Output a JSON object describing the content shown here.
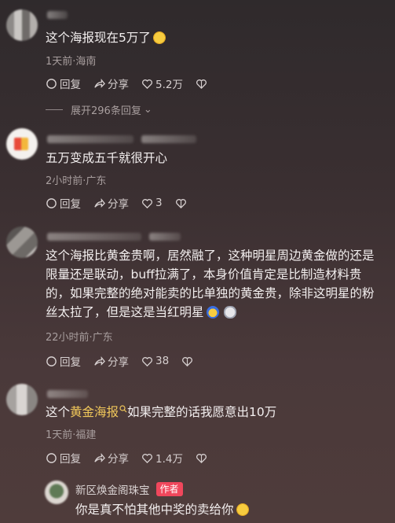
{
  "comments": [
    {
      "text": "这个海报现在5万了",
      "meta": "1天前·海南",
      "reply_label": "回复",
      "share_label": "分享",
      "like_count": "5.2万",
      "expand_label": "展开296条回复"
    },
    {
      "text": "五万变成五千就很开心",
      "meta": "2小时前·广东",
      "reply_label": "回复",
      "share_label": "分享",
      "like_count": "3"
    },
    {
      "lines": [
        "这个海报比黄金贵啊，居然融了，这种明星周边黄金做的还是",
        "限量还是联动，buff拉满了，本身价值肯定是比制造材料贵",
        "的，如果完整的绝对能卖的比单独的黄金贵，除非这明星的粉",
        "丝太拉了，但是这是当红明星"
      ],
      "meta": "22小时前·广东",
      "reply_label": "回复",
      "share_label": "分享",
      "like_count": "38"
    },
    {
      "text_pre": "这个",
      "text_highlight": "黄金海报",
      "text_post": "如果完整的话我愿意出10万",
      "meta": "1天前·福建",
      "reply_label": "回复",
      "share_label": "分享",
      "like_count": "1.4万"
    }
  ],
  "reply": {
    "username": "新区焕金阁珠宝",
    "tag": "作者",
    "text": "你是真不怕其他中奖的卖给你"
  },
  "icons": {
    "reply": "comment-bubble-icon",
    "share": "share-arrow-icon",
    "like": "heart-icon",
    "dislike": "dislike-heart-icon"
  },
  "colors": {
    "highlight": "#f0c75a",
    "author_tag": "#f0475c",
    "meta": "#a89e9e"
  }
}
